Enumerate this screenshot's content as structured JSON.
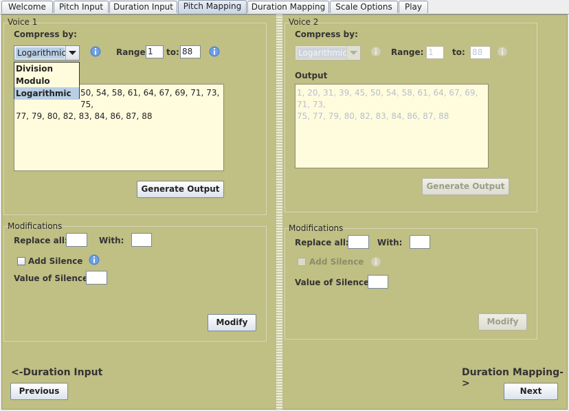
{
  "tabs": [
    "Welcome",
    "Pitch Input",
    "Duration Input",
    "Pitch Mapping",
    "Duration Mapping",
    "Scale Options",
    "Play"
  ],
  "selected_tab": "Pitch Mapping",
  "voice1": {
    "title": "Voice 1",
    "compress_label": "Compress by:",
    "compress_value": "Logarithmic",
    "dropdown_options": [
      "Division",
      "Modulo",
      "Logarithmic"
    ],
    "range_label": "Range:",
    "range_from": "1",
    "to_label": "to:",
    "range_to": "88",
    "output_visible_line1": "50, 54, 58, 61, 64, 67, 69, 71, 73, 75,",
    "output_visible_line2": "77, 79, 80, 82, 83, 84, 86, 87, 88",
    "generate_button": "Generate Output",
    "modifications": {
      "title": "Modifications",
      "replace_all_label": "Replace all:",
      "replace_all_value": "",
      "with_label": "With:",
      "with_value": "",
      "add_silence_label": "Add Silence",
      "add_silence_checked": false,
      "value_of_silence_label": "Value of Silence:",
      "value_of_silence": "",
      "modify_button": "Modify"
    }
  },
  "voice2": {
    "title": "Voice 2",
    "compress_label": "Compress by:",
    "compress_value": "Logarithmic",
    "range_label": "Range:",
    "range_from": "1",
    "to_label": "to:",
    "range_to": "88",
    "output_label": "Output",
    "output_line1": "1, 20, 31, 39, 45, 50, 54, 58, 61, 64, 67, 69, 71, 73,",
    "output_line2": "75, 77, 79, 80, 82, 83, 84, 86, 87, 88",
    "generate_button": "Generate Output",
    "modifications": {
      "title": "Modifications",
      "replace_all_label": "Replace all:",
      "replace_all_value": "",
      "with_label": "With:",
      "with_value": "",
      "add_silence_label": "Add Silence",
      "add_silence_checked": false,
      "value_of_silence_label": "Value of Silence:",
      "value_of_silence": "",
      "modify_button": "Modify"
    }
  },
  "nav": {
    "prev_label": "<-Duration Input",
    "prev_button": "Previous",
    "next_label": "Duration Mapping->",
    "next_button": "Next"
  },
  "colors": {
    "panel_bg": "#C0BF84",
    "textarea_bg": "#FFFCDE",
    "selection": "#B8CFE5",
    "info_icon": "#4F86D6"
  },
  "icons": [
    "info-icon",
    "chevron-down-icon"
  ]
}
